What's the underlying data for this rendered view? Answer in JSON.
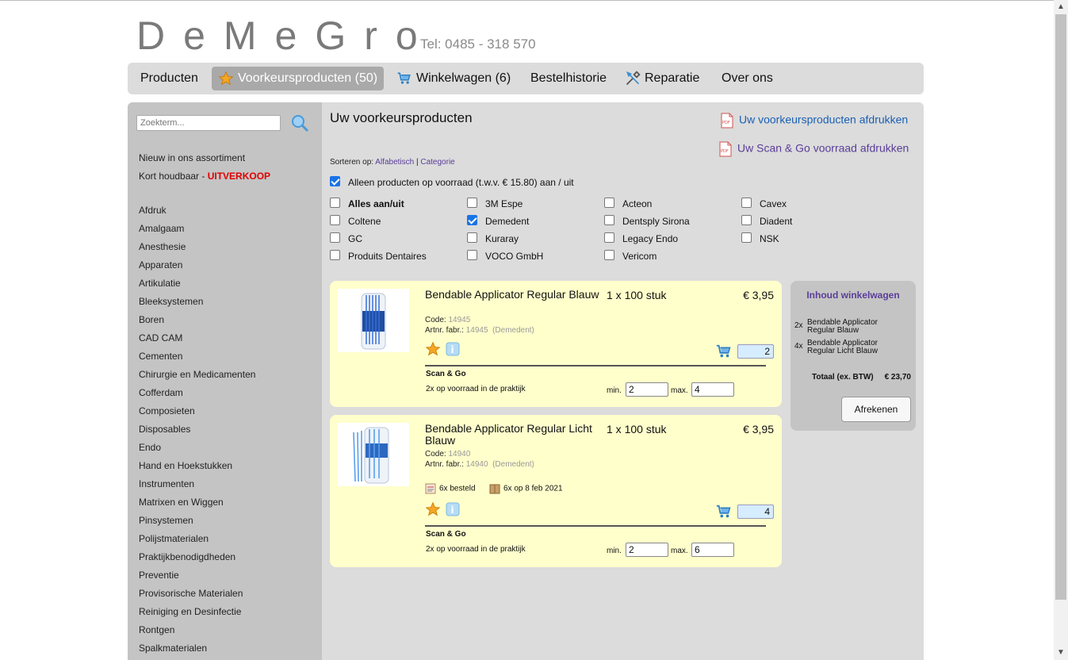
{
  "brand": {
    "logo": "DeMeGro",
    "phone": "Tel: 0485 - 318 570"
  },
  "nav": [
    {
      "label": "Producten",
      "icon": ""
    },
    {
      "label": "Voorkeursproducten (50)",
      "icon": "star-icon",
      "active": true
    },
    {
      "label": "Winkelwagen (6)",
      "icon": "cart-icon"
    },
    {
      "label": "Bestelhistorie",
      "icon": ""
    },
    {
      "label": "Reparatie",
      "icon": "tools-icon"
    },
    {
      "label": "Over ons",
      "icon": ""
    }
  ],
  "sidebar": {
    "search_placeholder": "Zoekterm...",
    "special": [
      "Nieuw in ons assortiment",
      "Kort houdbaar - ",
      "UITVERKOOP"
    ],
    "categories": [
      "Afdruk",
      "Amalgaam",
      "Anesthesie",
      "Apparaten",
      "Artikulatie",
      "Bleeksystemen",
      "Boren",
      "CAD CAM",
      "Cementen",
      "Chirurgie en Medicamenten",
      "Cofferdam",
      "Composieten",
      "Disposables",
      "Endo",
      "Hand en Hoekstukken",
      "Instrumenten",
      "Matrixen en Wiggen",
      "Pinsystemen",
      "Polijstmaterialen",
      "Praktijkbenodigdheden",
      "Preventie",
      "Provisorische Materialen",
      "Reiniging en Desinfectie",
      "Rontgen",
      "Spalkmaterialen"
    ]
  },
  "main": {
    "title": "Uw voorkeursproducten",
    "print1": "Uw voorkeursproducten afdrukken",
    "print2": "Uw Scan & Go voorraad afdrukken",
    "sort_label": "Sorteren op:",
    "sort_alpha": "Alfabetisch",
    "sort_sep": "|",
    "sort_cat": "Categorie",
    "stock_filter": {
      "label": "Alleen producten op voorraad (t.w.v. € 15.80) aan / uit",
      "checked": true
    },
    "filters": [
      {
        "label": "Alles aan/uit",
        "checked": false,
        "bold": true
      },
      {
        "label": "3M Espe",
        "checked": false
      },
      {
        "label": "Acteon",
        "checked": false
      },
      {
        "label": "Cavex",
        "checked": false
      },
      {
        "label": "Coltene",
        "checked": false
      },
      {
        "label": "Demedent",
        "checked": true
      },
      {
        "label": "Dentsply Sirona",
        "checked": false
      },
      {
        "label": "Diadent",
        "checked": false
      },
      {
        "label": "GC",
        "checked": false
      },
      {
        "label": "Kuraray",
        "checked": false
      },
      {
        "label": "Legacy Endo",
        "checked": false
      },
      {
        "label": "NSK",
        "checked": false
      },
      {
        "label": "Produits Dentaires",
        "checked": false
      },
      {
        "label": "VOCO GmbH",
        "checked": false
      },
      {
        "label": "Vericom",
        "checked": false
      }
    ]
  },
  "products": [
    {
      "name": "Bendable Applicator Regular Blauw",
      "pack": "1 x 100 stuk",
      "price": "€ 3,95",
      "code_label": "Code:",
      "code": "14945",
      "artnr_label": "Artnr. fabr.:",
      "artnr": "14945",
      "maker": "(Demedent)",
      "qty": "2",
      "sg_title": "Scan & Go",
      "sg_text": "2x op voorraad in de praktijk",
      "min_label": "min.",
      "min": "2",
      "max_label": "max.",
      "max": "4"
    },
    {
      "name": "Bendable Applicator Regular Licht Blauw",
      "pack": "1 x 100 stuk",
      "price": "€ 3,95",
      "code_label": "Code:",
      "code": "14940",
      "artnr_label": "Artnr. fabr.:",
      "artnr": "14940",
      "maker": "(Demedent)",
      "ordered": "6x besteld",
      "last_order": "6x op 8 feb 2021",
      "qty": "4",
      "sg_title": "Scan & Go",
      "sg_text": "2x op voorraad in de praktijk",
      "min_label": "min.",
      "min": "2",
      "max_label": "max.",
      "max": "6"
    }
  ],
  "cart": {
    "title": "Inhoud winkelwagen",
    "items": [
      {
        "qty": "2x",
        "name": "Bendable Applicator Regular Blauw"
      },
      {
        "qty": "4x",
        "name": "Bendable Applicator Regular Licht Blauw"
      }
    ],
    "total_label": "Totaal (ex. BTW)",
    "total": "€ 23,70",
    "checkout": "Afrekenen"
  },
  "colors": {
    "accent_link": "#5a3d99",
    "sale_red": "#e00000",
    "product_bg": "#ffffcc",
    "qty_bg": "#d6ecff"
  }
}
